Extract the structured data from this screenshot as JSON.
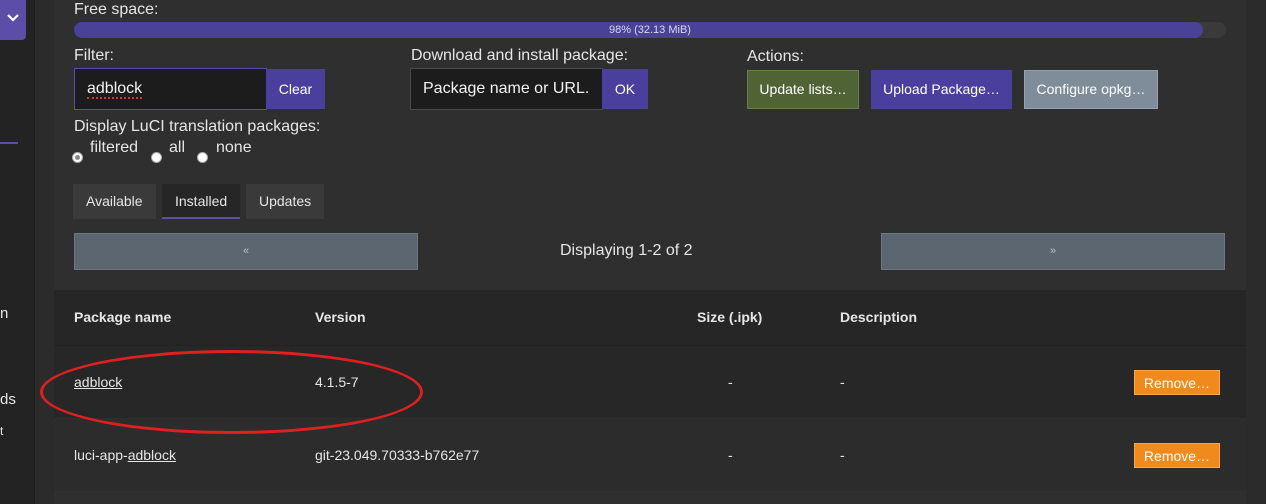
{
  "sidebar": {
    "fragments": [
      "n",
      "ds",
      "t"
    ]
  },
  "free_space": {
    "label": "Free space:",
    "percent": 98,
    "text": "98% (32.13 MiB)"
  },
  "filter": {
    "label": "Filter:",
    "value": "adblock",
    "clear_label": "Clear"
  },
  "download": {
    "label": "Download and install package:",
    "placeholder": "Package name or URL.",
    "ok_label": "OK"
  },
  "actions": {
    "label": "Actions:",
    "update_lists": "Update lists…",
    "upload_package": "Upload Package…",
    "configure_opkg": "Configure opkg…"
  },
  "translation": {
    "label": "Display LuCI translation packages:",
    "options": [
      "filtered",
      "all",
      "none"
    ],
    "selected": "filtered"
  },
  "tabs": [
    "Available",
    "Installed",
    "Updates"
  ],
  "active_tab": "Installed",
  "pager": {
    "prev": "«",
    "next": "»",
    "status": "Displaying 1-2 of 2"
  },
  "table": {
    "headers": [
      "Package name",
      "Version",
      "Size (.ipk)",
      "Description"
    ],
    "rows": [
      {
        "name_prefix": "",
        "name_link": "adblock",
        "version": "4.1.5-7",
        "size": "-",
        "description": "-",
        "action": "Remove…"
      },
      {
        "name_prefix": "luci-app-",
        "name_link": "adblock",
        "version": "git-23.049.70333-b762e77",
        "size": "-",
        "description": "-",
        "action": "Remove…"
      }
    ]
  },
  "colors": {
    "accent": "#5b4da8",
    "remove": "#f08a1c",
    "annotation": "#e02020"
  }
}
